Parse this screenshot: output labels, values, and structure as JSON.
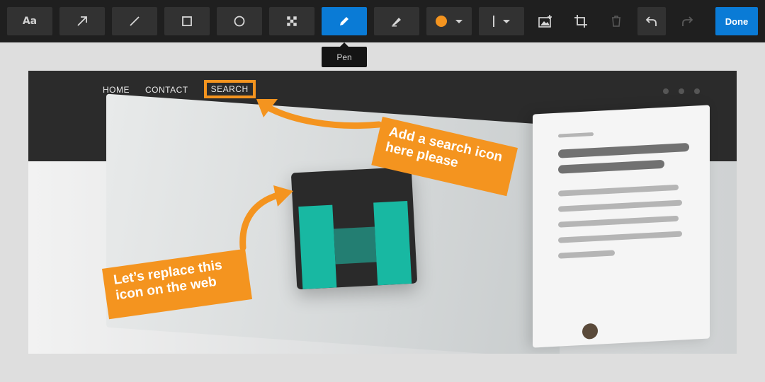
{
  "toolbar": {
    "text_tool_label": "Aa",
    "tools": [
      {
        "name": "text",
        "icon": "text-icon"
      },
      {
        "name": "arrow",
        "icon": "arrow-icon"
      },
      {
        "name": "line",
        "icon": "line-icon"
      },
      {
        "name": "rectangle",
        "icon": "rectangle-icon"
      },
      {
        "name": "ellipse",
        "icon": "circle-icon"
      },
      {
        "name": "pixelate",
        "icon": "pixelate-icon"
      },
      {
        "name": "pen",
        "icon": "pen-icon",
        "active": true
      },
      {
        "name": "highlighter",
        "icon": "highlighter-icon"
      }
    ],
    "color_value": "#f4941f",
    "stroke_value": "thin",
    "actions": [
      "add-image",
      "crop",
      "delete",
      "undo",
      "redo"
    ],
    "done_label": "Done",
    "active_color": "#0a7bd6"
  },
  "tooltip": {
    "text": "Pen"
  },
  "screenshot": {
    "nav": [
      "HOME",
      "CONTACT",
      "SEARCH"
    ],
    "selected_nav": "SEARCH"
  },
  "annotations": {
    "note1_line1": "Add a search icon",
    "note1_line2": "here please",
    "note2_line1": "Let’s replace this",
    "note2_line2": "icon on the web",
    "color": "#f4941f"
  }
}
